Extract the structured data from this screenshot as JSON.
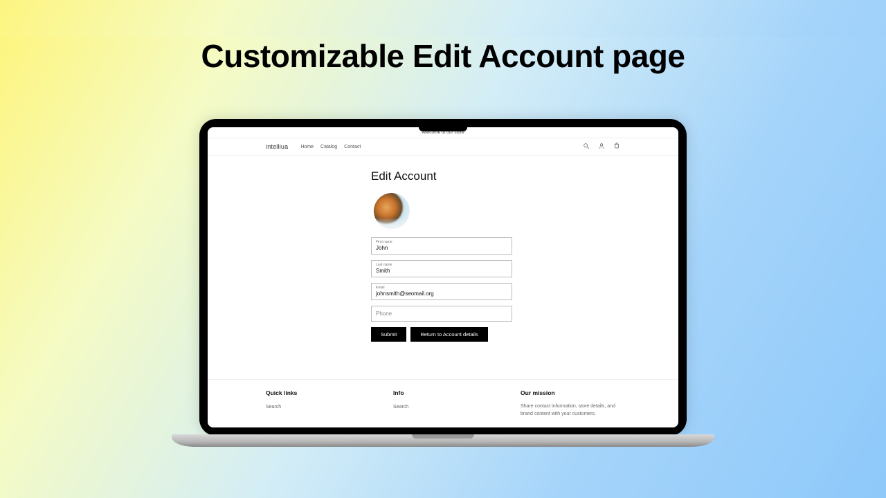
{
  "promo_title": "Customizable Edit Account page",
  "announce": "Welcome to our store",
  "brand": "intelliua",
  "nav": {
    "home": "Home",
    "catalog": "Catalog",
    "contact": "Contact"
  },
  "page_title": "Edit Account",
  "fields": {
    "first_name_label": "First name",
    "first_name_value": "John",
    "last_name_label": "Last name",
    "last_name_value": "Smith",
    "email_label": "Email",
    "email_value": "johnsmith@seomail.org",
    "phone_placeholder": "Phone"
  },
  "buttons": {
    "submit": "Submit",
    "return": "Return to Account details"
  },
  "footer": {
    "col1_title": "Quick links",
    "col1_link": "Search",
    "col2_title": "Info",
    "col2_link": "Search",
    "col3_title": "Our mission",
    "col3_text": "Share contact information, store details, and brand content with your customers."
  }
}
